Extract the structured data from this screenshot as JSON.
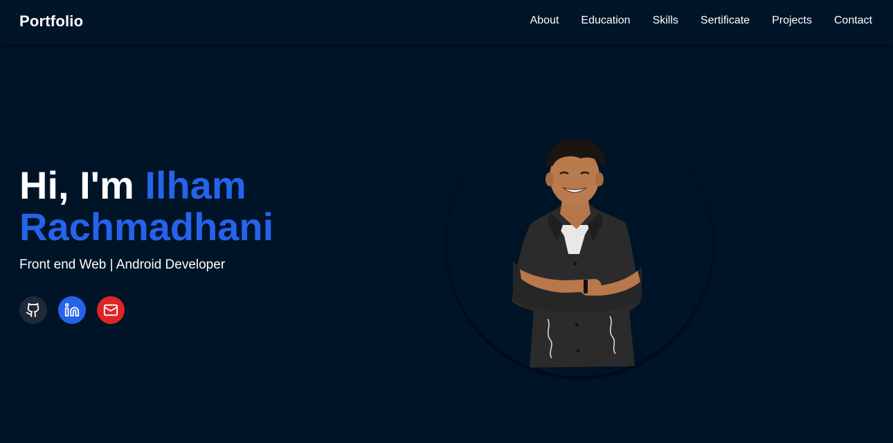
{
  "brand": "Portfolio",
  "nav": [
    "About",
    "Education",
    "Skills",
    "Sertificate",
    "Projects",
    "Contact"
  ],
  "hero": {
    "greeting": "Hi, I'm ",
    "name": "Ilham Rachmadhani",
    "subtitle": "Front end Web | Android Developer"
  },
  "social": [
    {
      "name": "github-icon",
      "color": "#1f2937"
    },
    {
      "name": "linkedin-icon",
      "color": "#2563eb"
    },
    {
      "name": "mail-icon",
      "color": "#dc2626"
    }
  ],
  "colors": {
    "background": "#001428",
    "accent": "#2563eb",
    "text": "#ffffff"
  }
}
